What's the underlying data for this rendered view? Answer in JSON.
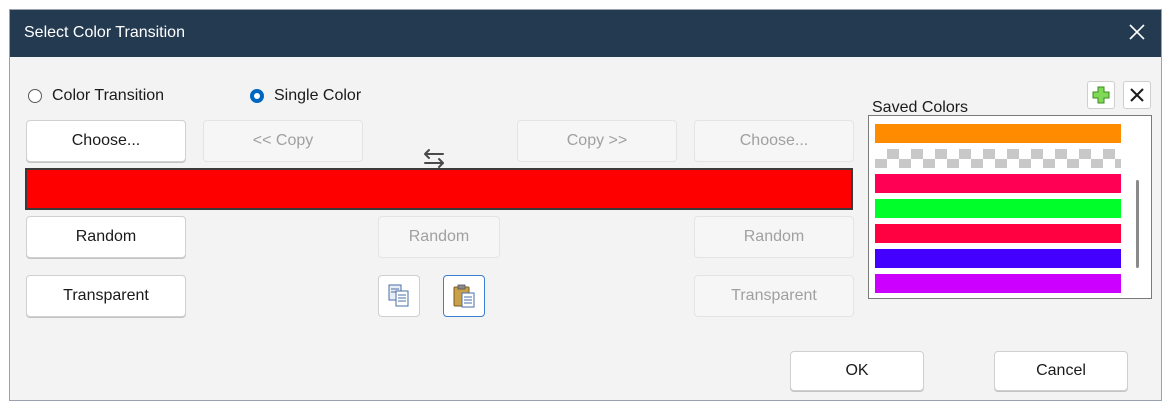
{
  "window": {
    "title": "Select Color Transition"
  },
  "mode": {
    "options": [
      {
        "label": "Color Transition",
        "selected": false
      },
      {
        "label": "Single Color",
        "selected": true
      }
    ]
  },
  "left": {
    "choose_label": "Choose...",
    "random_label": "Random",
    "transparent_label": "Transparent"
  },
  "middle": {
    "copy_left_label": "<< Copy",
    "copy_right_label": "Copy >>",
    "random_label": "Random",
    "swap_icon": "swap-arrows-icon",
    "copy_icon": "copy-pages-icon",
    "paste_icon": "paste-clipboard-icon"
  },
  "right": {
    "choose_label": "Choose...",
    "random_label": "Random",
    "transparent_label": "Transparent"
  },
  "preview": {
    "color": "#ff0000"
  },
  "saved": {
    "label": "Saved Colors",
    "add_icon": "plus-icon",
    "delete_icon": "close-icon",
    "colors": [
      "#ff8c00",
      "transparent",
      "#ff0055",
      "#00ff2a",
      "#ff0040",
      "#4400ff",
      "#cc00ff"
    ]
  },
  "footer": {
    "ok_label": "OK",
    "cancel_label": "Cancel"
  }
}
